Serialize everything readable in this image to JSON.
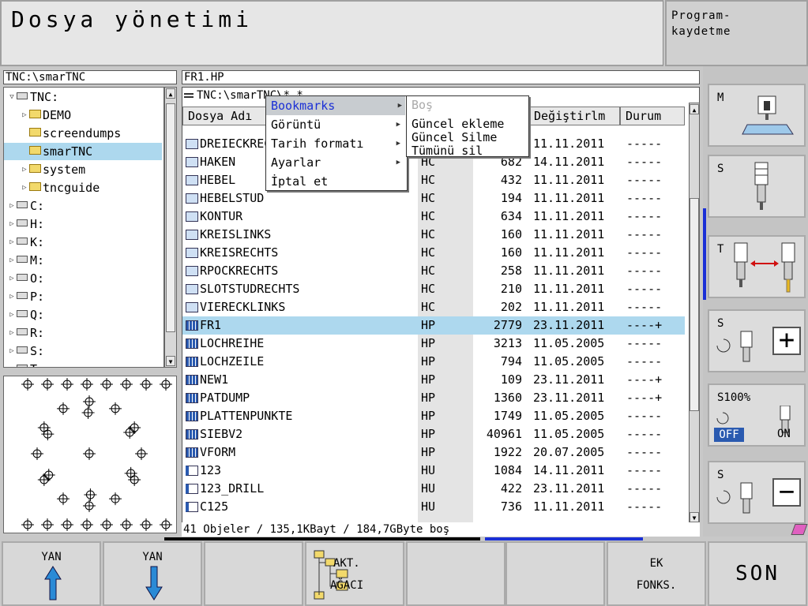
{
  "title": "Dosya yönetimi",
  "mode_label": "Program-\nkaydetme",
  "path_left": "TNC:\\smarTNC",
  "path_right": "FR1.HP",
  "file_subpath": "TNC:\\smarTNC\\*.*",
  "tree": [
    {
      "label": "TNC:",
      "kind": "drive",
      "expander": "▽",
      "indent": 0
    },
    {
      "label": "DEMO",
      "kind": "folder",
      "expander": "▷",
      "indent": 1
    },
    {
      "label": "screendumps",
      "kind": "folder",
      "expander": "",
      "indent": 1
    },
    {
      "label": "smarTNC",
      "kind": "folder",
      "expander": "",
      "indent": 1,
      "selected": true
    },
    {
      "label": "system",
      "kind": "folder",
      "expander": "▷",
      "indent": 1
    },
    {
      "label": "tncguide",
      "kind": "folder",
      "expander": "▷",
      "indent": 1
    },
    {
      "label": "C:",
      "kind": "drive",
      "expander": "▷",
      "indent": 0
    },
    {
      "label": "H:",
      "kind": "net",
      "expander": "▷",
      "indent": 0
    },
    {
      "label": "K:",
      "kind": "net",
      "expander": "▷",
      "indent": 0
    },
    {
      "label": "M:",
      "kind": "net",
      "expander": "▷",
      "indent": 0
    },
    {
      "label": "O:",
      "kind": "net",
      "expander": "▷",
      "indent": 0
    },
    {
      "label": "P:",
      "kind": "net",
      "expander": "▷",
      "indent": 0
    },
    {
      "label": "Q:",
      "kind": "net",
      "expander": "▷",
      "indent": 0
    },
    {
      "label": "R:",
      "kind": "net",
      "expander": "▷",
      "indent": 0
    },
    {
      "label": "S:",
      "kind": "net",
      "expander": "▷",
      "indent": 0
    },
    {
      "label": "T:",
      "kind": "net",
      "expander": "▷",
      "indent": 0
    }
  ],
  "columns": {
    "name": "Dosya Adı",
    "modified": "Değiştirlm",
    "status": "Durum"
  },
  "files": [
    {
      "name": "DREIECKRECHTS",
      "type": "HC",
      "size": "",
      "date": "11.11.2011",
      "status": "-----",
      "icon": "hc"
    },
    {
      "name": "HAKEN",
      "type": "HC",
      "size": "682",
      "date": "14.11.2011",
      "status": "-----",
      "icon": "hc"
    },
    {
      "name": "HEBEL",
      "type": "HC",
      "size": "432",
      "date": "11.11.2011",
      "status": "-----",
      "icon": "hc"
    },
    {
      "name": "HEBELSTUD",
      "type": "HC",
      "size": "194",
      "date": "11.11.2011",
      "status": "-----",
      "icon": "hc"
    },
    {
      "name": "KONTUR",
      "type": "HC",
      "size": "634",
      "date": "11.11.2011",
      "status": "-----",
      "icon": "hc"
    },
    {
      "name": "KREISLINKS",
      "type": "HC",
      "size": "160",
      "date": "11.11.2011",
      "status": "-----",
      "icon": "hc"
    },
    {
      "name": "KREISRECHTS",
      "type": "HC",
      "size": "160",
      "date": "11.11.2011",
      "status": "-----",
      "icon": "hc"
    },
    {
      "name": "RPOCKRECHTS",
      "type": "HC",
      "size": "258",
      "date": "11.11.2011",
      "status": "-----",
      "icon": "hc"
    },
    {
      "name": "SLOTSTUDRECHTS",
      "type": "HC",
      "size": "210",
      "date": "11.11.2011",
      "status": "-----",
      "icon": "hc"
    },
    {
      "name": "VIERECKLINKS",
      "type": "HC",
      "size": "202",
      "date": "11.11.2011",
      "status": "-----",
      "icon": "hc"
    },
    {
      "name": "FR1",
      "type": "HP",
      "size": "2779",
      "date": "23.11.2011",
      "status": "----+",
      "icon": "hp",
      "selected": true
    },
    {
      "name": "LOCHREIHE",
      "type": "HP",
      "size": "3213",
      "date": "11.05.2005",
      "status": "-----",
      "icon": "hp"
    },
    {
      "name": "LOCHZEILE",
      "type": "HP",
      "size": "794",
      "date": "11.05.2005",
      "status": "-----",
      "icon": "hp"
    },
    {
      "name": "NEW1",
      "type": "HP",
      "size": "109",
      "date": "23.11.2011",
      "status": "----+",
      "icon": "hp"
    },
    {
      "name": "PATDUMP",
      "type": "HP",
      "size": "1360",
      "date": "23.11.2011",
      "status": "----+",
      "icon": "hp"
    },
    {
      "name": "PLATTENPUNKTE",
      "type": "HP",
      "size": "1749",
      "date": "11.05.2005",
      "status": "-----",
      "icon": "hp"
    },
    {
      "name": "SIEBV2",
      "type": "HP",
      "size": "40961",
      "date": "11.05.2005",
      "status": "-----",
      "icon": "hp"
    },
    {
      "name": "VFORM",
      "type": "HP",
      "size": "1922",
      "date": "20.07.2005",
      "status": "-----",
      "icon": "hp"
    },
    {
      "name": "123",
      "type": "HU",
      "size": "1084",
      "date": "14.11.2011",
      "status": "-----",
      "icon": "hu"
    },
    {
      "name": "123_DRILL",
      "type": "HU",
      "size": "422",
      "date": "23.11.2011",
      "status": "-----",
      "icon": "hu"
    },
    {
      "name": "C125",
      "type": "HU",
      "size": "736",
      "date": "11.11.2011",
      "status": "-----",
      "icon": "hu"
    }
  ],
  "status_line": "41 Objeler / 135,1KBayt / 184,7GByte boş",
  "menu": {
    "items": [
      "Bookmarks",
      "Görüntü",
      "Tarih formatı",
      "Ayarlar",
      "İptal et"
    ],
    "submenu": [
      "Boş",
      "Güncel ekleme",
      "Güncel Silme",
      "Tümünü sil"
    ]
  },
  "right_panel": {
    "m_label": "M",
    "s_label": "S",
    "t_label": "T",
    "s_plus_label": "S",
    "s100_label": "S100%",
    "off_label": "OFF",
    "on_label": "ON",
    "s_minus_label": "S"
  },
  "softkeys": {
    "yan1": "YAN",
    "yan2": "YAN",
    "akt_line1": "AKT.",
    "akt_line2": "AĞACI",
    "ek_line1": "EK",
    "ek_line2": "FONKS.",
    "son": "SON"
  },
  "colors": {
    "selection": "#add8ee",
    "menu_highlight_text": "#1a2fd6",
    "off_badge": "#2a5ab0"
  }
}
